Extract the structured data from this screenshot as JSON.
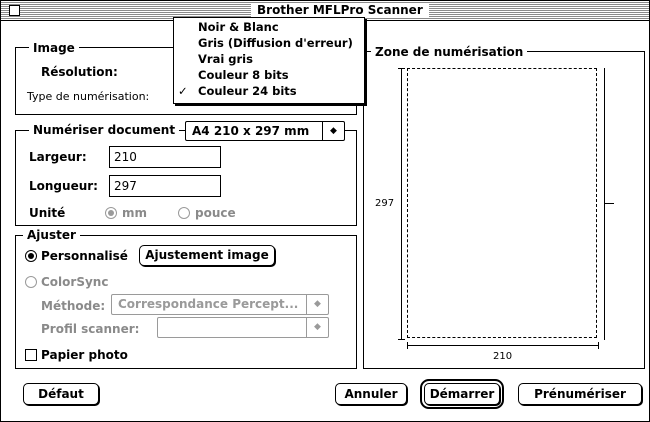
{
  "window": {
    "title": "Brother MFLPro Scanner"
  },
  "image_group": {
    "title": "Image",
    "resolution_label": "Résolution:",
    "scan_type_label": "Type de numérisation:"
  },
  "scan_type_menu": {
    "items": [
      "Noir & Blanc",
      "Gris (Diffusion d'erreur)",
      "Vrai gris",
      "Couleur 8 bits",
      "Couleur 24 bits"
    ],
    "selected": "Couleur 24 bits",
    "check_glyph": "✓"
  },
  "document_group": {
    "title": "Numériser document",
    "size_value": "A4 210 x 297 mm",
    "width_label": "Largeur:",
    "width_value": "210",
    "length_label": "Longueur:",
    "length_value": "297",
    "unit_label": "Unité",
    "unit_mm": "mm",
    "unit_inch": "pouce"
  },
  "adjust_group": {
    "title": "Ajuster",
    "custom_label": "Personnalisé",
    "adjust_image_button": "Ajustement image",
    "colorsync_label": "ColorSync",
    "method_label": "Méthode:",
    "method_value": "Correspondance Percept...",
    "profile_label": "Profil scanner:",
    "profile_value": ""
  },
  "photo_paper_label": "Papier photo",
  "zone": {
    "title": "Zone de numérisation",
    "height_value": "297",
    "width_value": "210"
  },
  "buttons": {
    "default": "Défaut",
    "cancel": "Annuler",
    "start": "Démarrer",
    "prescan": "Prénumériser"
  }
}
